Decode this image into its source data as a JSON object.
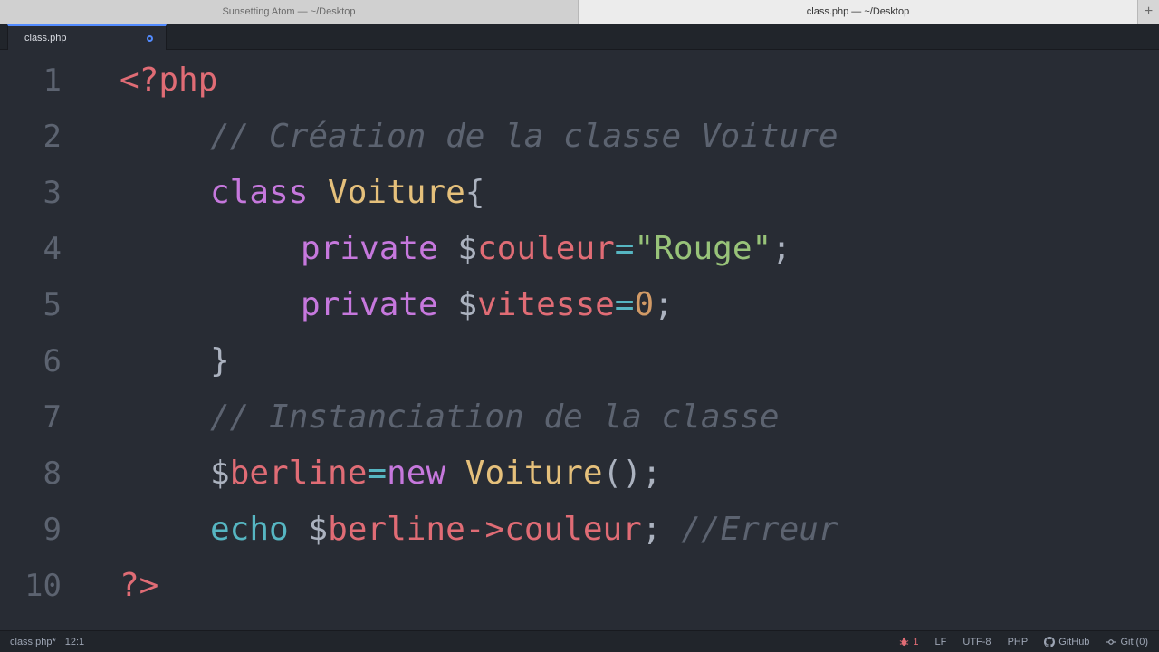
{
  "window": {
    "tabs": [
      {
        "label": "Sunsetting Atom — ~/Desktop",
        "active": false
      },
      {
        "label": "class.php — ~/Desktop",
        "active": true
      }
    ],
    "add_tab_icon": "plus-icon"
  },
  "editor_tab": {
    "title": "class.php",
    "modified_indicator": "modified-dot-icon"
  },
  "code": {
    "line_numbers": [
      "1",
      "2",
      "3",
      "4",
      "5",
      "6",
      "7",
      "8",
      "9",
      "10"
    ],
    "lines": [
      [
        {
          "t": "<?php",
          "c": "kw-tag"
        }
      ],
      [
        {
          "t": "// Création de la classe Voiture",
          "c": "tok-comment"
        }
      ],
      [
        {
          "t": "class ",
          "c": "tok-keyword"
        },
        {
          "t": "Voiture",
          "c": "tok-class"
        },
        {
          "t": "{",
          "c": "tok-punct"
        }
      ],
      [
        {
          "t": "private ",
          "c": "tok-keyword"
        },
        {
          "t": "$",
          "c": "tok-dollar"
        },
        {
          "t": "couleur",
          "c": "tok-var"
        },
        {
          "t": "=",
          "c": "tok-op"
        },
        {
          "t": "\"Rouge\"",
          "c": "tok-string"
        },
        {
          "t": ";",
          "c": "tok-punct"
        }
      ],
      [
        {
          "t": "private ",
          "c": "tok-keyword"
        },
        {
          "t": "$",
          "c": "tok-dollar"
        },
        {
          "t": "vitesse",
          "c": "tok-var"
        },
        {
          "t": "=",
          "c": "tok-op"
        },
        {
          "t": "0",
          "c": "tok-number"
        },
        {
          "t": ";",
          "c": "tok-punct"
        }
      ],
      [
        {
          "t": "}",
          "c": "tok-punct"
        }
      ],
      [
        {
          "t": "// Instanciation de la classe",
          "c": "tok-comment"
        }
      ],
      [
        {
          "t": "$",
          "c": "tok-dollar"
        },
        {
          "t": "berline",
          "c": "tok-var"
        },
        {
          "t": "=",
          "c": "tok-op"
        },
        {
          "t": "new ",
          "c": "tok-keyword"
        },
        {
          "t": "Voiture",
          "c": "tok-class"
        },
        {
          "t": "();",
          "c": "tok-punct"
        }
      ],
      [
        {
          "t": "echo ",
          "c": "tok-echo"
        },
        {
          "t": "$",
          "c": "tok-dollar"
        },
        {
          "t": "berline",
          "c": "tok-var"
        },
        {
          "t": "->",
          "c": "tok-var"
        },
        {
          "t": "couleur",
          "c": "tok-var"
        },
        {
          "t": "; ",
          "c": "tok-punct"
        },
        {
          "t": "//Erreur",
          "c": "tok-comment"
        }
      ],
      [
        {
          "t": "?>",
          "c": "kw-tag"
        }
      ]
    ]
  },
  "status_bar": {
    "file": "class.php*",
    "cursor": "12:1",
    "issues_count": "1",
    "line_ending": "LF",
    "encoding": "UTF-8",
    "grammar": "PHP",
    "github": "GitHub",
    "git": "Git (0)"
  },
  "colors": {
    "background": "#282c34",
    "accent": "#528bff",
    "tag": "#e06c75",
    "keyword": "#c678dd",
    "class": "#e5c07b",
    "string": "#98c379",
    "number": "#d19a66",
    "operator": "#56b6c2",
    "comment": "#5c6370"
  }
}
